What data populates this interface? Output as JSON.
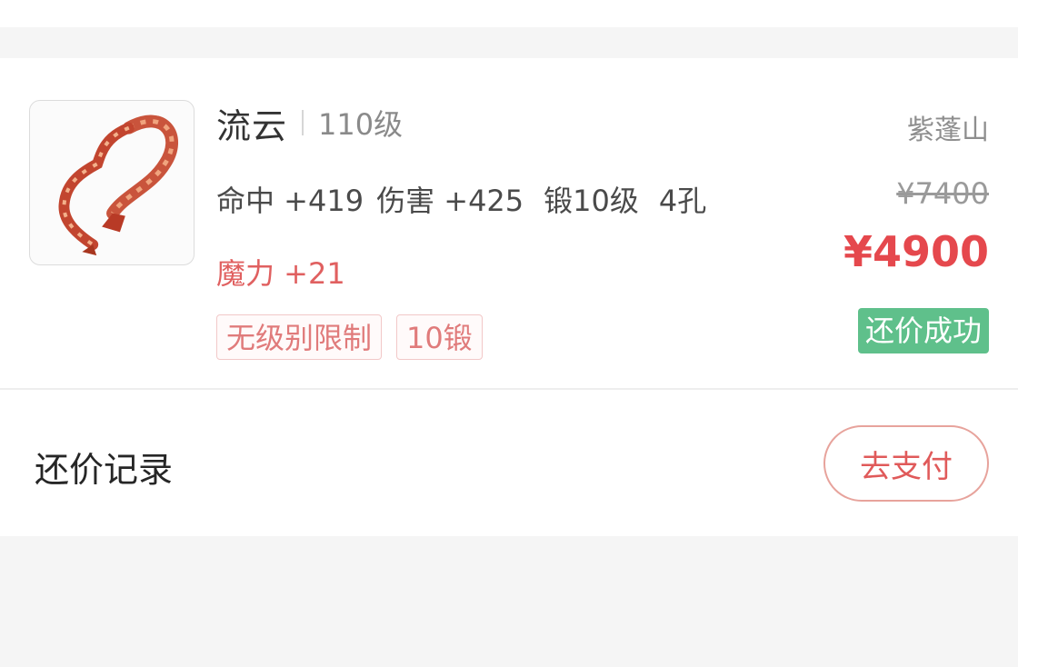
{
  "item": {
    "name": "流云",
    "level": "110级",
    "server": "紫蓬山",
    "stats": [
      "命中 +419",
      "伤害 +425",
      "锻10级",
      "4孔"
    ],
    "magic_attr": "魔力 +21",
    "tags": [
      "无级别限制",
      "10锻"
    ],
    "image_icon": "ribbon-item-image"
  },
  "price": {
    "original": "¥7400",
    "current": "¥4900",
    "status": "还价成功"
  },
  "footer": {
    "record_label": "还价记录",
    "pay_label": "去支付"
  },
  "colors": {
    "price_red": "#e5484d",
    "status_green": "#5fc08b",
    "tag_text": "#e07b7b",
    "tag_border": "#f2c8c8",
    "page_gray": "#f5f5f5"
  }
}
